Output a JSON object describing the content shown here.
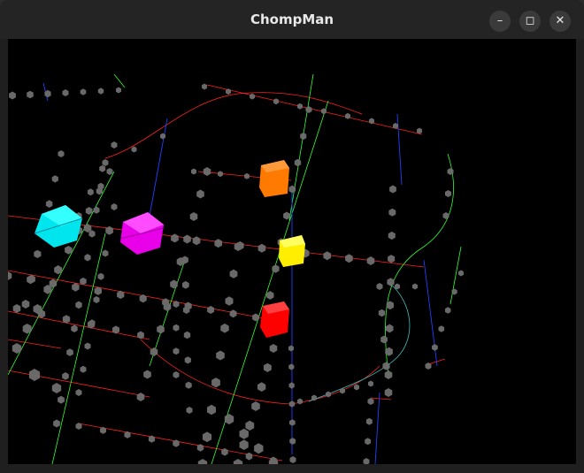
{
  "window": {
    "title": "ChompMan",
    "buttons": {
      "minimize": "–",
      "maximize": "◻",
      "close": "✕"
    }
  },
  "scene": {
    "background": "#000000",
    "ghost_colors": {
      "cyan": "#00ffff",
      "magenta": "#ff00ff",
      "orange": "#ff8000",
      "yellow": "#ffff00",
      "red": "#ff0000"
    },
    "pellet_color": "#6f6f6f",
    "line_colors": {
      "x_axis": "#ff2020",
      "y_axis": "#30ff30",
      "z_axis": "#2040ff",
      "path": "#40c0c0"
    }
  }
}
